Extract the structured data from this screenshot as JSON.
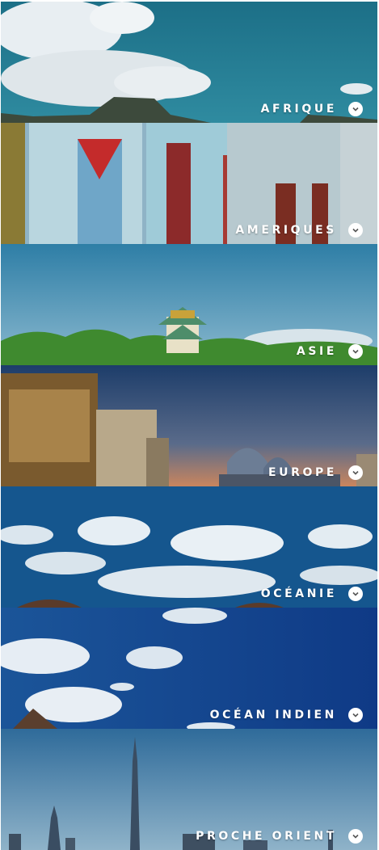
{
  "regions": [
    {
      "label": "AFRIQUE",
      "icon": "chevron-down-icon"
    },
    {
      "label": "AMERIQUES",
      "icon": "chevron-down-icon"
    },
    {
      "label": "ASIE",
      "icon": "chevron-down-icon"
    },
    {
      "label": "EUROPE",
      "icon": "chevron-down-icon"
    },
    {
      "label": "OCÉANIE",
      "icon": "chevron-down-icon"
    },
    {
      "label": "OCÉAN INDIEN",
      "icon": "chevron-down-icon"
    },
    {
      "label": "PROCHE ORIENT",
      "icon": "chevron-down-icon"
    }
  ]
}
